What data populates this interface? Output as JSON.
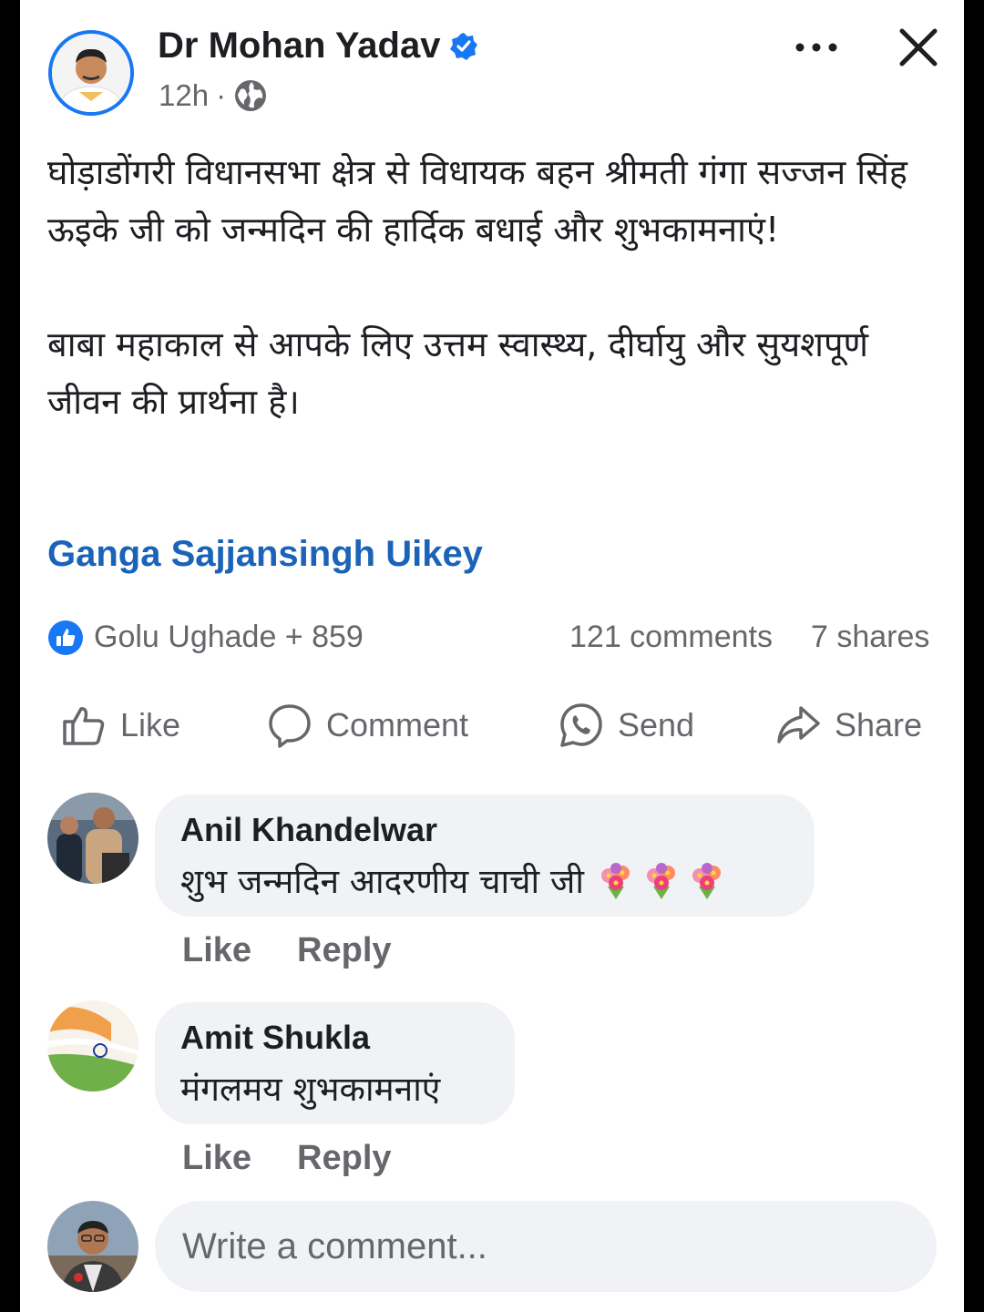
{
  "post": {
    "author": "Dr Mohan Yadav",
    "time": "12h",
    "separator": "·",
    "paragraphs": [
      "घोड़ाडोंगरी विधानसभा क्षेत्र से विधायक बहन श्रीमती गंगा सज्जन सिंह ऊइके जी को जन्मदिन की हार्दिक बधाई और शुभकामनाएं!",
      "बाबा महाकाल से आपके लिए उत्तम स्वास्थ्य, दीर्घायु और सुयशपूर्ण जीवन की प्रार्थना है।"
    ],
    "tagged": "Ganga Sajjansingh Uikey",
    "reactions": "Golu Ughade + 859",
    "comments_count": "121 comments",
    "shares_count": "7 shares"
  },
  "actions": {
    "like": "Like",
    "comment": "Comment",
    "send": "Send",
    "share": "Share"
  },
  "comments": [
    {
      "name": "Anil Khandelwar",
      "text": "शुभ जन्मदिन आदरणीय चाची जी",
      "like": "Like",
      "reply": "Reply"
    },
    {
      "name": "Amit Shukla",
      "text": "मंगलमय शुभकामनाएं",
      "like": "Like",
      "reply": "Reply"
    }
  ],
  "composer": {
    "placeholder": "Write a comment..."
  },
  "colors": {
    "accent": "#1877f2",
    "tag_link": "#1a63b8",
    "secondary_text": "#65676b",
    "bubble": "#f0f2f5"
  },
  "icons": [
    "verified-badge-icon",
    "globe-icon",
    "more-options-icon",
    "close-icon",
    "like-reaction-icon",
    "thumbs-up-icon",
    "comment-icon",
    "whatsapp-icon",
    "share-icon",
    "flower-bouquet-icon"
  ]
}
